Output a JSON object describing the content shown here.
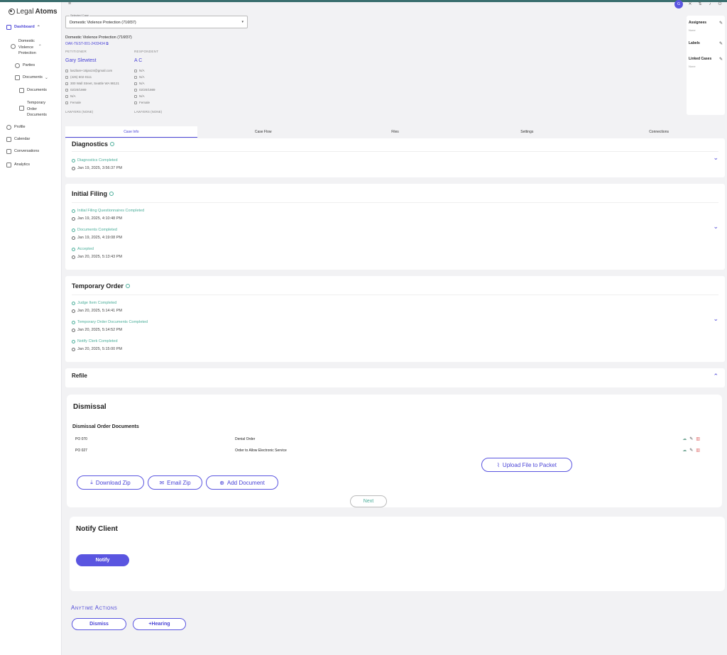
{
  "app": {
    "logo_light": "Legal",
    "logo_bold": "Atoms"
  },
  "sidebar": {
    "dashboard": "Dashboard",
    "case_name": [
      "Domestic",
      "Violence",
      "Protection"
    ],
    "parties": "Parties",
    "documents": "Documents",
    "documents_sub": "Documents",
    "temporary_order": [
      "Temporary",
      "Order",
      "Documents"
    ],
    "profile": "Profile",
    "calendar": "Calendar",
    "conversations": "Conversations",
    "analytics": "Analytics"
  },
  "header": {
    "hamburger": "≡",
    "avatar_initial": "G"
  },
  "case_select": {
    "label": "Selected Case",
    "value": "Domestic Violence Protection (716f37)"
  },
  "case": {
    "title": "Domestic Violence Protection (716f37)",
    "id": "OAK-TEST-001-2433434",
    "petitioner": {
      "role": "PETITIONER",
      "name": "Gary Slewtest",
      "email": "laszlare+16jan24@gmail.com",
      "phone": "(425) 502-0111",
      "address": "300 Wall Street, Seattle WA 98121",
      "dob": "02/20/1989",
      "other": "N/A",
      "gender": "Female",
      "lawyers": "LAWYERS (NONE)"
    },
    "respondent": {
      "role": "RESPONDENT",
      "name": "A C",
      "email": "N/A",
      "phone": "N/A",
      "address": "N/A",
      "dob": "02/20/1989",
      "other": "N/A",
      "gender": "Female",
      "lawyers": "LAWYERS (NONE)"
    }
  },
  "side_panel": {
    "assignees": "Assignees",
    "assignees_val": "None",
    "labels": "Labels",
    "linked": "Linked Cases",
    "linked_val": "None"
  },
  "tabs": [
    "Case Info",
    "Case Flow",
    "Files",
    "Settings",
    "Connections"
  ],
  "diagnostics": {
    "title": "Diagnostics",
    "items": [
      {
        "status": "Diagnostics Completed",
        "time": "Jan 19, 2025, 3:56:37 PM"
      }
    ]
  },
  "initial_filing": {
    "title": "Initial Filing",
    "items": [
      {
        "status": "Initial Filing Questionnaires Completed",
        "time": "Jan 19, 2025, 4:10:48 PM"
      },
      {
        "status": "Documents Completed",
        "time": "Jan 19, 2025, 4:19:08 PM"
      },
      {
        "status": "Accepted",
        "time": "Jan 20, 2025, 5:13:43 PM"
      }
    ]
  },
  "temporary_order": {
    "title": "Temporary Order",
    "items": [
      {
        "status": "Judge Item Completed",
        "time": "Jan 20, 2025, 5:14:41 PM"
      },
      {
        "status": "Temporary Order Documents Completed",
        "time": "Jan 20, 2025, 5:14:52 PM"
      },
      {
        "status": "Notify Clerk Completed",
        "time": "Jan 20, 2025, 5:15:00 PM"
      }
    ]
  },
  "refile": {
    "title": "Refile"
  },
  "dismissal": {
    "title": "Dismissal",
    "subtitle": "Dismissal Order Documents",
    "docs": [
      {
        "code": "PO 070",
        "desc": "Denial Order"
      },
      {
        "code": "PO 027",
        "desc": "Order to Allow Electronic Service"
      }
    ],
    "upload": "Upload File to Packet",
    "download_zip": "Download Zip",
    "email_zip": "Email Zip",
    "add_document": "Add Document",
    "next": "Next"
  },
  "notify_client": {
    "title": "Notify Client",
    "button": "Notify"
  },
  "anytime": {
    "title": "Anytime Actions",
    "dismiss": "Dismiss",
    "hearing": "+Hearing"
  },
  "colors": {
    "accent": "#5a55e0",
    "success": "#4cae9a",
    "danger": "#d66666"
  }
}
